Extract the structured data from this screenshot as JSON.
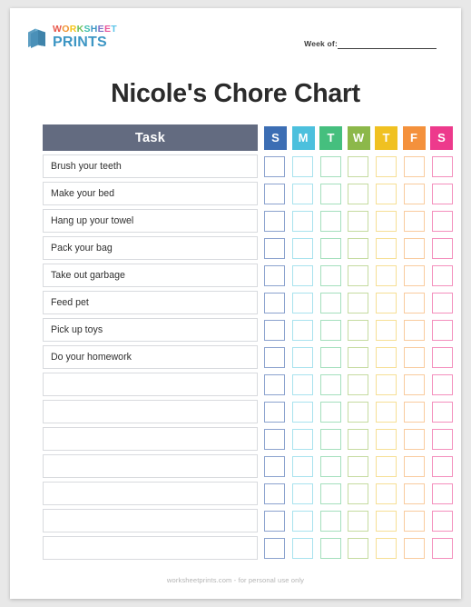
{
  "brand": {
    "icon": "stacked-papers-icon",
    "line1": "WORKSHEET",
    "line2": "PRINTS",
    "line1_letter_colors": [
      "#e8564a",
      "#f0912d",
      "#f5c518",
      "#6cbf5a",
      "#3fbfb0",
      "#3d96c4",
      "#7b6ec4",
      "#e8569a",
      "#5ac4e8"
    ],
    "line2_color": "#3d96c4",
    "icon_color": "#4a90b8"
  },
  "week_of": {
    "label": "Week of:",
    "value": ""
  },
  "title": "Nicole's Chore Chart",
  "table": {
    "task_header": "Task",
    "task_header_bg": "#636b80",
    "days": [
      {
        "label": "S",
        "name": "sunday",
        "header_bg": "#3c6eb4",
        "box_border": "#8ba2ce"
      },
      {
        "label": "M",
        "name": "monday",
        "header_bg": "#4cc0dd",
        "box_border": "#a8e2ee"
      },
      {
        "label": "T",
        "name": "tuesday",
        "header_bg": "#45bf7e",
        "box_border": "#a4dfbd"
      },
      {
        "label": "W",
        "name": "wednesday",
        "header_bg": "#8cb84a",
        "box_border": "#c5dba0"
      },
      {
        "label": "T",
        "name": "thursday",
        "header_bg": "#f0c121",
        "box_border": "#f6df95"
      },
      {
        "label": "F",
        "name": "friday",
        "header_bg": "#f4913c",
        "box_border": "#f9cb9e"
      },
      {
        "label": "S",
        "name": "saturday",
        "header_bg": "#ed3a8c",
        "box_border": "#f48fbd"
      }
    ],
    "rows": [
      {
        "task": "Brush your teeth"
      },
      {
        "task": "Make your bed"
      },
      {
        "task": "Hang up your towel"
      },
      {
        "task": "Pack your bag"
      },
      {
        "task": "Take out garbage"
      },
      {
        "task": "Feed pet"
      },
      {
        "task": "Pick up toys"
      },
      {
        "task": "Do your homework"
      },
      {
        "task": ""
      },
      {
        "task": ""
      },
      {
        "task": ""
      },
      {
        "task": ""
      },
      {
        "task": ""
      },
      {
        "task": ""
      },
      {
        "task": ""
      }
    ]
  },
  "footer": "worksheetprints.com - for personal use only"
}
